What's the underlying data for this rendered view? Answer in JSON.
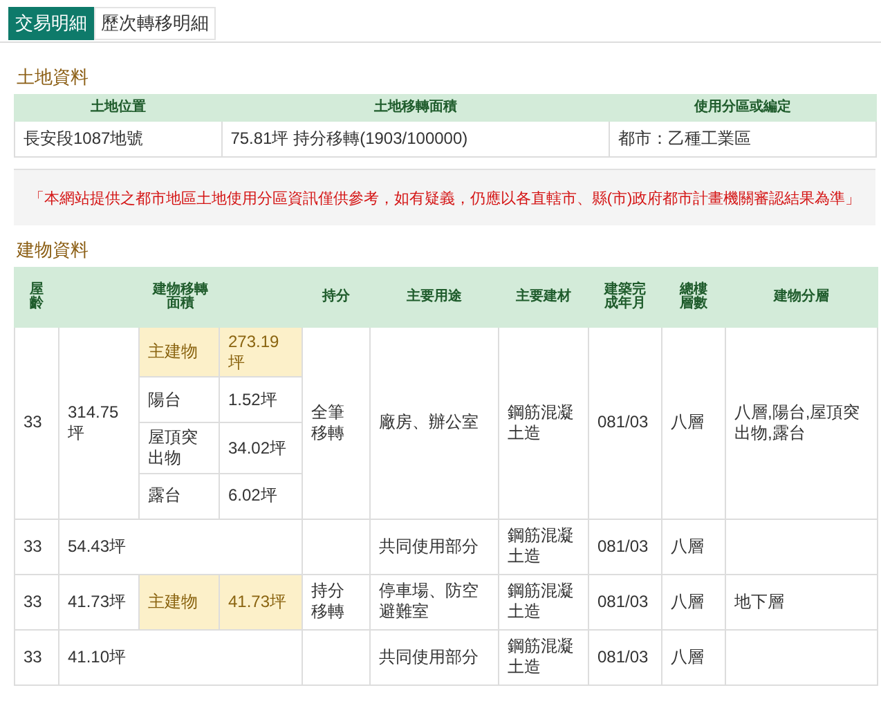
{
  "tabs": [
    {
      "label": "交易明細",
      "selected": true
    },
    {
      "label": "歷次轉移明細",
      "selected": false
    }
  ],
  "land": {
    "title": "土地資料",
    "columns": [
      "土地位置",
      "土地移轉面積",
      "使用分區或編定"
    ],
    "rows": [
      [
        "長安段1087地號",
        "75.81坪 持分移轉(1903/100000)",
        "都市：乙種工業區"
      ]
    ]
  },
  "notice": "「本網站提供之都市地區土地使用分區資訊僅供參考，如有疑義，仍應以各直轄市、縣(市)政府都市計畫機關審認結果為準」",
  "building": {
    "title": "建物資料",
    "columns": [
      "屋齡",
      "建物移轉面積",
      "持分",
      "主要用途",
      "主要建材",
      "建築完成年月",
      "總樓層數",
      "建物分層"
    ],
    "rows": [
      {
        "age": "33",
        "area": "314.75坪",
        "parts": [
          {
            "kind": "main",
            "label": "主建物",
            "value": "273.19坪"
          },
          {
            "kind": "attached",
            "label": "陽台",
            "value": "1.52坪"
          },
          {
            "kind": "attached",
            "label": "屋頂突出物",
            "value": "34.02坪"
          },
          {
            "kind": "attached",
            "label": "露台",
            "value": "6.02坪"
          }
        ],
        "share": "全筆移轉",
        "use": "廠房、辦公室",
        "material": "鋼筋混凝土造",
        "completed": "081/03",
        "floors": "八層",
        "levels": "八層,陽台,屋頂突出物,露台"
      },
      {
        "age": "33",
        "area": "54.43坪",
        "parts": [],
        "use": "共同使用部分",
        "material": "鋼筋混凝土造",
        "completed": "081/03",
        "floors": "八層"
      },
      {
        "age": "33",
        "area": "41.73坪",
        "parts": [
          {
            "kind": "main",
            "label": "主建物",
            "value": "41.73坪"
          }
        ],
        "share": "持分移轉",
        "use": "停車場、防空避難室",
        "material": "鋼筋混凝土造",
        "completed": "081/03",
        "floors": "八層",
        "levels": "地下層"
      },
      {
        "age": "33",
        "area": "41.10坪",
        "parts": [],
        "use": "共同使用部分",
        "material": "鋼筋混凝土造",
        "completed": "081/03",
        "floors": "八層"
      }
    ]
  }
}
